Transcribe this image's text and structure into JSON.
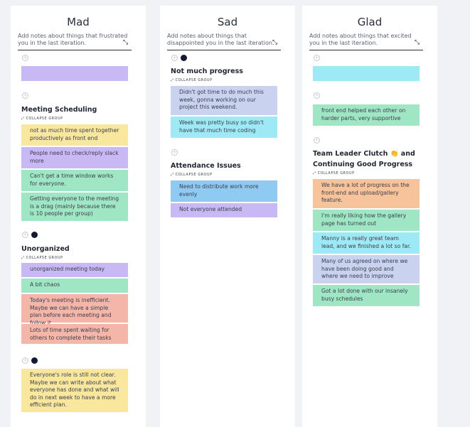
{
  "columns": [
    {
      "title": "Mad",
      "description": "Add notes about things that frustrated you in the last iteration.",
      "groups": [
        {
          "title": "Meeting Scheduling",
          "collapse_label": "COLLAPSE GROUP",
          "cards": [
            "not as much time spent together productively as front end",
            "People need to check/reply slack more",
            "Can't get a time window works for everyone.",
            "Getting everyone to the meeting is a drag (mainly because there is 10 people per group)"
          ]
        },
        {
          "title": "Unorganized",
          "collapse_label": "COLLAPSE GROUP",
          "cards": [
            "unorganized meeting today",
            "A bit chaos",
            "Today's meeting is inefficient. Maybe we can have a simple plan before each meeting and follow it.",
            "Lots of time spent waiting for others to complete their tasks"
          ]
        }
      ],
      "loose_cards": [
        "",
        "Everyone's role is still not clear. Maybe we can write about what everyone has done and what will do in next week to have a more efficient plan."
      ]
    },
    {
      "title": "Sad",
      "description": "Add notes about things that disappointed you in the last iteration.",
      "groups": [
        {
          "title": "Not much progress",
          "collapse_label": "COLLAPSE GROUP",
          "cards": [
            "Didn't got time to do much this week, gonna working on our project this weekend.",
            "Week was pretty busy so didn't have that much time coding"
          ]
        },
        {
          "title": "Attendance Issues",
          "collapse_label": "COLLAPSE GROUP",
          "cards": [
            "Need to distribute work more evenly",
            "Not everyone attended"
          ]
        }
      ]
    },
    {
      "title": "Glad",
      "description": "Add notes about things that excited you in the last iteration.",
      "groups": [
        {
          "title": "Team Leader Clutch 👏 and Continuing Good Progress",
          "collapse_label": "COLLAPSE GROUP",
          "cards": [
            "We have a lot of progress on the front-end and upload/gallery feature.",
            "I'm really liking how the gallery page has turned out",
            "Manny is a really great team lead, and we finished a lot so far.",
            "Many of us agreed on where we have been doing good and where we need to improve",
            "Got a lot done with our insanely busy schedules"
          ]
        }
      ],
      "loose_cards": [
        "",
        "front end helped each other on harder parts, very supportive"
      ]
    }
  ],
  "icons": {
    "add": "plus-circle-icon",
    "expand": "expand-arrows-icon",
    "collapse": "collapse-arrows-icon",
    "vote": "vote-dot-icon"
  },
  "colors": {
    "purple": "#c8b8f3",
    "yellow": "#f8e79c",
    "green": "#9fe6c5",
    "salmon": "#f3b6a8",
    "blue_gray": "#c9d3f0",
    "cyan": "#9de9f5",
    "blue": "#8fcaf3",
    "orange": "#f6c39a"
  }
}
